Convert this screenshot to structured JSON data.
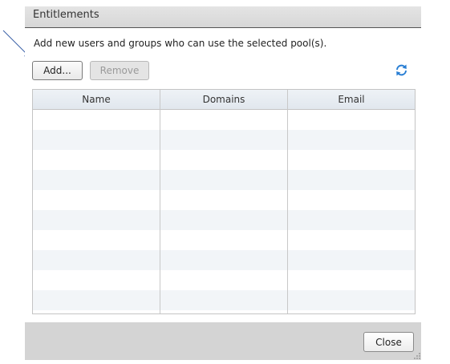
{
  "dialog": {
    "title": "Entitlements",
    "description": "Add new users and groups who can use the selected pool(s).",
    "toolbar": {
      "add_label": "Add...",
      "remove_label": "Remove",
      "refresh_icon": "refresh-icon"
    },
    "table": {
      "columns": [
        "Name",
        "Domains",
        "Email"
      ],
      "rows": []
    },
    "footer": {
      "close_label": "Close"
    }
  },
  "colors": {
    "titlebar": "#dcdcdc",
    "footer": "#d4d4d4",
    "grid_alt_row": "#f2f5f8",
    "grid_header": "#e6ebf1",
    "refresh_icon": "#2a7fd4",
    "annotation_arrow": "#3a5fa8"
  }
}
